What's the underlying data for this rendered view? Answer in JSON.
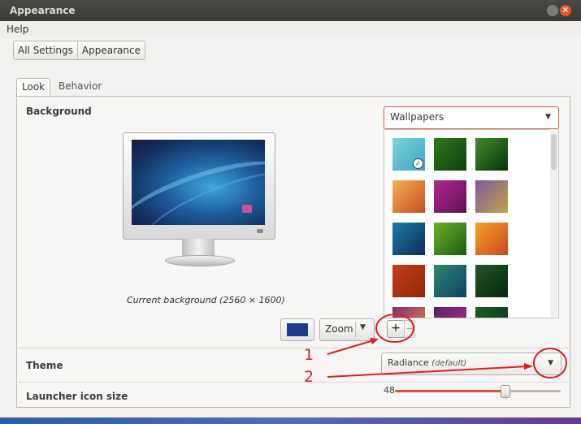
{
  "window": {
    "title": "Appearance"
  },
  "menubar": {
    "help": "Help"
  },
  "breadcrumb": {
    "all_settings": "All Settings",
    "appearance": "Appearance"
  },
  "tabs": [
    {
      "label": "Look"
    },
    {
      "label": "Behavior"
    }
  ],
  "background": {
    "section_label": "Background",
    "caption": "Current background (2560 × 1600)",
    "color_swatch": "#1e3b8c",
    "zoom": {
      "label": "Zoom"
    },
    "wallpaper_source": "Wallpapers",
    "thumbnails": [
      {
        "name": "cyan-warty",
        "colors": [
          "#7fd4dc",
          "#3aa7c0"
        ],
        "selected": true
      },
      {
        "name": "green-curves",
        "colors": [
          "#2f7a1e",
          "#0d3f0c"
        ]
      },
      {
        "name": "green-dark",
        "colors": [
          "#3f8f2a",
          "#0a300c"
        ]
      },
      {
        "name": "orange-petals",
        "colors": [
          "#f2b15a",
          "#c84d1e"
        ]
      },
      {
        "name": "magenta-fold",
        "colors": [
          "#b02a8e",
          "#5e0f57"
        ]
      },
      {
        "name": "violet-lines",
        "colors": [
          "#7d5b9b",
          "#c2a24a"
        ]
      },
      {
        "name": "teal-blur",
        "colors": [
          "#1f7aa8",
          "#0b2d5a"
        ]
      },
      {
        "name": "leaf-green",
        "colors": [
          "#6bb324",
          "#1a5a17"
        ]
      },
      {
        "name": "orange-diamonds",
        "colors": [
          "#f5a32a",
          "#c9471d"
        ]
      },
      {
        "name": "red-marbles",
        "colors": [
          "#c9391c",
          "#8d2a0c"
        ]
      },
      {
        "name": "blue-green-wave",
        "colors": [
          "#2c8a6e",
          "#0e3f6a"
        ]
      },
      {
        "name": "forest-dark",
        "colors": [
          "#1e5a24",
          "#0a2410"
        ]
      },
      {
        "name": "purple-orange",
        "colors": [
          "#7a2e84",
          "#f38a2a"
        ]
      },
      {
        "name": "purple-dark",
        "colors": [
          "#5c1f70",
          "#b0347a"
        ]
      },
      {
        "name": "dark-green-dots",
        "colors": [
          "#1d5f2a",
          "#0b2a14"
        ]
      }
    ],
    "add_label": "+",
    "remove_label": "−"
  },
  "theme": {
    "section_label": "Theme",
    "selected": "Radiance",
    "selected_hint": "(default)"
  },
  "launcher": {
    "section_label": "Launcher icon size",
    "value": "48",
    "value_fraction": 0.66
  },
  "annotations": [
    {
      "label": "1"
    },
    {
      "label": "2"
    }
  ],
  "colors": {
    "annotation_red": "#e0201a",
    "accent_orange": "#e1542d"
  }
}
